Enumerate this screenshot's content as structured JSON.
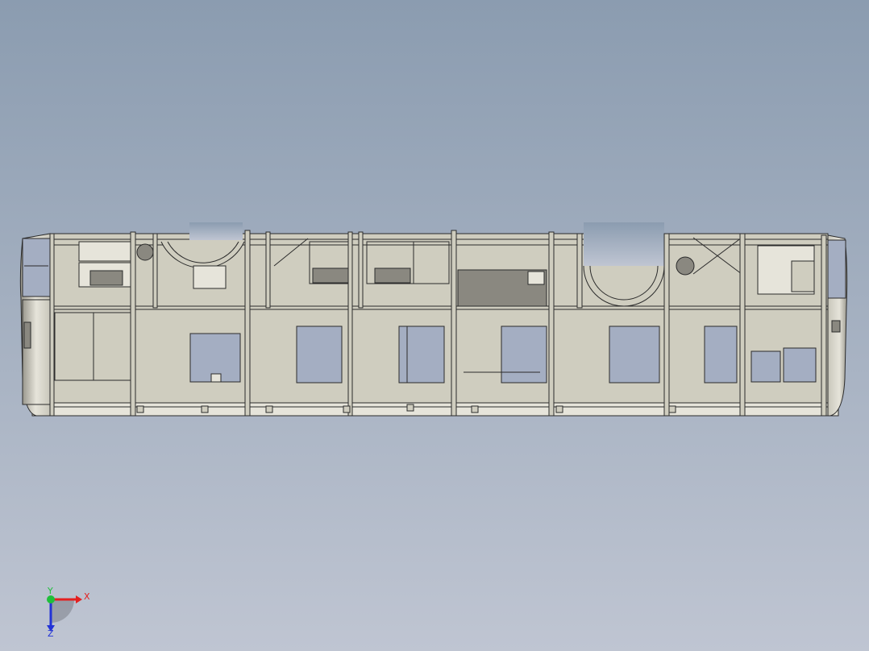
{
  "viewport": {
    "bg_top": "#8b9cb0",
    "bg_bottom": "#bfc5d2"
  },
  "model": {
    "body_fill": "#cfcdbf",
    "body_light": "#e6e4da",
    "body_shade": "#b8b6aa",
    "glass": "#a4aec2",
    "line": "#2b2b2b",
    "dark_panel": "#8a8880"
  },
  "triad": {
    "x_label": "X",
    "y_label": "Y",
    "z_label": "Z",
    "x_color": "#e32020",
    "y_color": "#1fbf3a",
    "z_color": "#2233d6"
  }
}
